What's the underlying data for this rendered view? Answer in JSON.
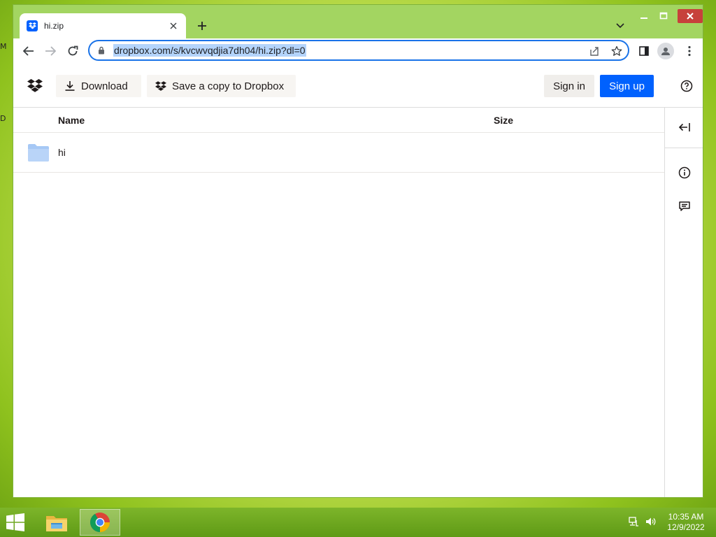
{
  "browser": {
    "tab_title": "hi.zip",
    "url": "dropbox.com/s/kvcwvqdjia7dh04/hi.zip?dl=0"
  },
  "page": {
    "download_label": "Download",
    "save_copy_label": "Save a copy to Dropbox",
    "sign_in_label": "Sign in",
    "sign_up_label": "Sign up"
  },
  "filelist": {
    "headers": {
      "name": "Name",
      "size": "Size"
    },
    "rows": [
      {
        "name": "hi",
        "size": "",
        "type": "folder"
      }
    ]
  },
  "taskbar": {
    "time": "10:35 AM",
    "date": "12/9/2022"
  },
  "colors": {
    "primary": "#0061fe",
    "folder": "#a6c8f5",
    "window_frame": "#a3d561"
  }
}
